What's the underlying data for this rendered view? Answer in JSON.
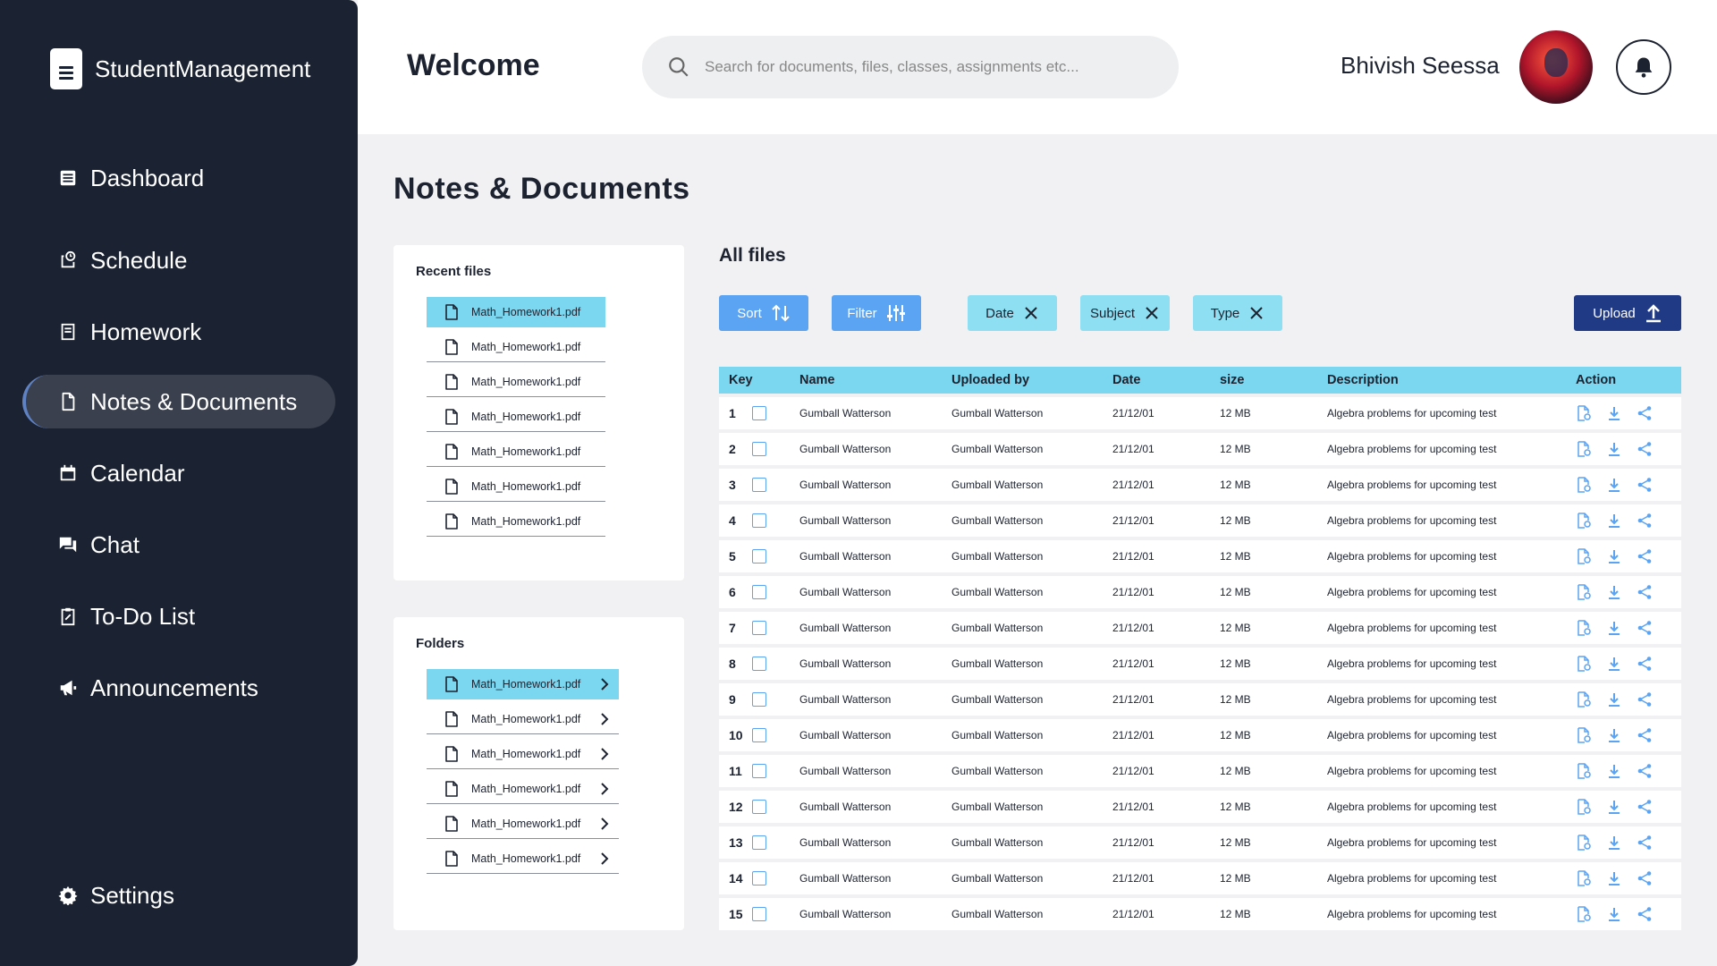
{
  "app": {
    "name": "StudentManagement"
  },
  "sidebar": {
    "items": [
      {
        "label": "Dashboard",
        "icon": "dashboard-icon"
      },
      {
        "label": "Schedule",
        "icon": "schedule-icon"
      },
      {
        "label": "Homework",
        "icon": "homework-icon"
      },
      {
        "label": "Notes & Documents",
        "icon": "document-icon",
        "active": true
      },
      {
        "label": "Calendar",
        "icon": "calendar-icon"
      },
      {
        "label": "Chat",
        "icon": "chat-icon"
      },
      {
        "label": "To-Do List",
        "icon": "clipboard-icon"
      },
      {
        "label": "Announcements",
        "icon": "megaphone-icon"
      }
    ],
    "settings_label": "Settings"
  },
  "header": {
    "welcome": "Welcome",
    "search_placeholder": "Search for documents, files, classes, assignments etc...",
    "username": "Bhivish Seessa"
  },
  "page": {
    "title": "Notes & Documents"
  },
  "recent_files": {
    "title": "Recent files",
    "items": [
      "Math_Homework1.pdf",
      "Math_Homework1.pdf",
      "Math_Homework1.pdf",
      "Math_Homework1.pdf",
      "Math_Homework1.pdf",
      "Math_Homework1.pdf",
      "Math_Homework1.pdf"
    ]
  },
  "folders": {
    "title": "Folders",
    "items": [
      "Math_Homework1.pdf",
      "Math_Homework1.pdf",
      "Math_Homework1.pdf",
      "Math_Homework1.pdf",
      "Math_Homework1.pdf",
      "Math_Homework1.pdf"
    ]
  },
  "all_files": {
    "title": "All files",
    "toolbar": {
      "sort": "Sort",
      "filter": "Filter",
      "chips": [
        "Date",
        "Subject",
        "Type"
      ],
      "upload": "Upload"
    },
    "columns": {
      "key": "Key",
      "name": "Name",
      "uploaded_by": "Uploaded by",
      "date": "Date",
      "size": "size",
      "description": "Description",
      "action": "Action"
    },
    "rows": [
      {
        "key": "1",
        "name": "Gumball Watterson",
        "uploaded_by": "Gumball Watterson",
        "date": "21/12/01",
        "size": "12 MB",
        "description": "Algebra problems for upcoming test"
      },
      {
        "key": "2",
        "name": "Gumball Watterson",
        "uploaded_by": "Gumball Watterson",
        "date": "21/12/01",
        "size": "12 MB",
        "description": "Algebra problems for upcoming test"
      },
      {
        "key": "3",
        "name": "Gumball Watterson",
        "uploaded_by": "Gumball Watterson",
        "date": "21/12/01",
        "size": "12 MB",
        "description": "Algebra problems for upcoming test"
      },
      {
        "key": "4",
        "name": "Gumball Watterson",
        "uploaded_by": "Gumball Watterson",
        "date": "21/12/01",
        "size": "12 MB",
        "description": "Algebra problems for upcoming test"
      },
      {
        "key": "5",
        "name": "Gumball Watterson",
        "uploaded_by": "Gumball Watterson",
        "date": "21/12/01",
        "size": "12 MB",
        "description": "Algebra problems for upcoming test"
      },
      {
        "key": "6",
        "name": "Gumball Watterson",
        "uploaded_by": "Gumball Watterson",
        "date": "21/12/01",
        "size": "12 MB",
        "description": "Algebra problems for upcoming test"
      },
      {
        "key": "7",
        "name": "Gumball Watterson",
        "uploaded_by": "Gumball Watterson",
        "date": "21/12/01",
        "size": "12 MB",
        "description": "Algebra problems for upcoming test"
      },
      {
        "key": "8",
        "name": "Gumball Watterson",
        "uploaded_by": "Gumball Watterson",
        "date": "21/12/01",
        "size": "12 MB",
        "description": "Algebra problems for upcoming test"
      },
      {
        "key": "9",
        "name": "Gumball Watterson",
        "uploaded_by": "Gumball Watterson",
        "date": "21/12/01",
        "size": "12 MB",
        "description": "Algebra problems for upcoming test"
      },
      {
        "key": "10",
        "name": "Gumball Watterson",
        "uploaded_by": "Gumball Watterson",
        "date": "21/12/01",
        "size": "12 MB",
        "description": "Algebra problems for upcoming test"
      },
      {
        "key": "11",
        "name": "Gumball Watterson",
        "uploaded_by": "Gumball Watterson",
        "date": "21/12/01",
        "size": "12 MB",
        "description": "Algebra problems for upcoming test"
      },
      {
        "key": "12",
        "name": "Gumball Watterson",
        "uploaded_by": "Gumball Watterson",
        "date": "21/12/01",
        "size": "12 MB",
        "description": "Algebra problems for upcoming test"
      },
      {
        "key": "13",
        "name": "Gumball Watterson",
        "uploaded_by": "Gumball Watterson",
        "date": "21/12/01",
        "size": "12 MB",
        "description": "Algebra problems for upcoming test"
      },
      {
        "key": "14",
        "name": "Gumball Watterson",
        "uploaded_by": "Gumball Watterson",
        "date": "21/12/01",
        "size": "12 MB",
        "description": "Algebra problems for upcoming test"
      },
      {
        "key": "15",
        "name": "Gumball Watterson",
        "uploaded_by": "Gumball Watterson",
        "date": "21/12/01",
        "size": "12 MB",
        "description": "Algebra problems for upcoming test"
      }
    ]
  },
  "colors": {
    "sidebar_bg": "#1b2231",
    "accent_cyan": "#7ad7ef",
    "button_blue": "#5ba4f3",
    "upload_navy": "#213a86"
  }
}
